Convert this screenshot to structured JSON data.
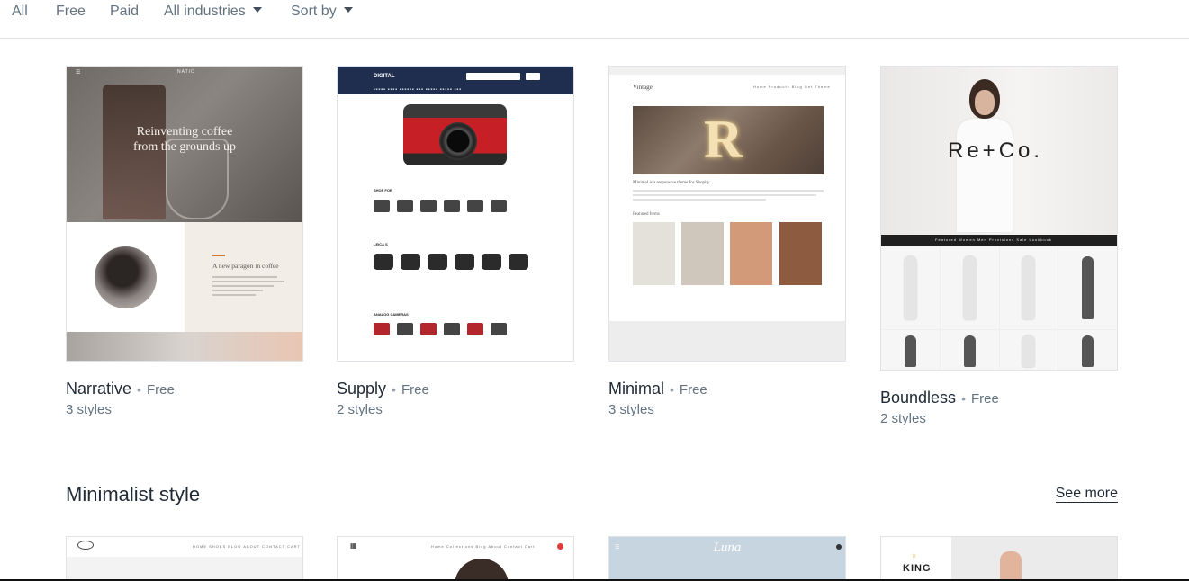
{
  "filters": {
    "all": "All",
    "free": "Free",
    "paid": "Paid",
    "industries": "All industries",
    "sort": "Sort by"
  },
  "themes": [
    {
      "name": "Narrative",
      "price": "Free",
      "styles": "3 styles",
      "preview": {
        "logo": "NATIO",
        "headline_1": "Reinventing coffee",
        "headline_2": "from the grounds up",
        "subheadline": "A new paragon in coffee"
      }
    },
    {
      "name": "Supply",
      "price": "Free",
      "styles": "2 styles",
      "preview": {
        "logo": "DIGITAL",
        "section_1": "SHOP FOR",
        "section_2": "LEICA S",
        "section_3": "ANALOG CAMERAS"
      }
    },
    {
      "name": "Minimal",
      "price": "Free",
      "styles": "3 styles",
      "preview": {
        "logo": "Vintage",
        "nav": "Home   Products   Blog   Get Theme",
        "tagline": "Minimal is a responsive theme for Shopify",
        "featured": "Featured Items"
      }
    },
    {
      "name": "Boundless",
      "price": "Free",
      "styles": "2 styles",
      "preview": {
        "logo": "Re+Co.",
        "nav": "Featured   Women   Men   Provisions   Sale   Lookbook"
      }
    }
  ],
  "section": {
    "title": "Minimalist style",
    "see_more": "See more",
    "previews": [
      {
        "nav": "HOME   SHOES   BLOG   ABOUT   CONTACT   CART"
      },
      {
        "nav": "Home   Collections   Blog   About   Contact   Cart"
      },
      {
        "logo": "Luna"
      },
      {
        "logo": "KING"
      }
    ]
  }
}
